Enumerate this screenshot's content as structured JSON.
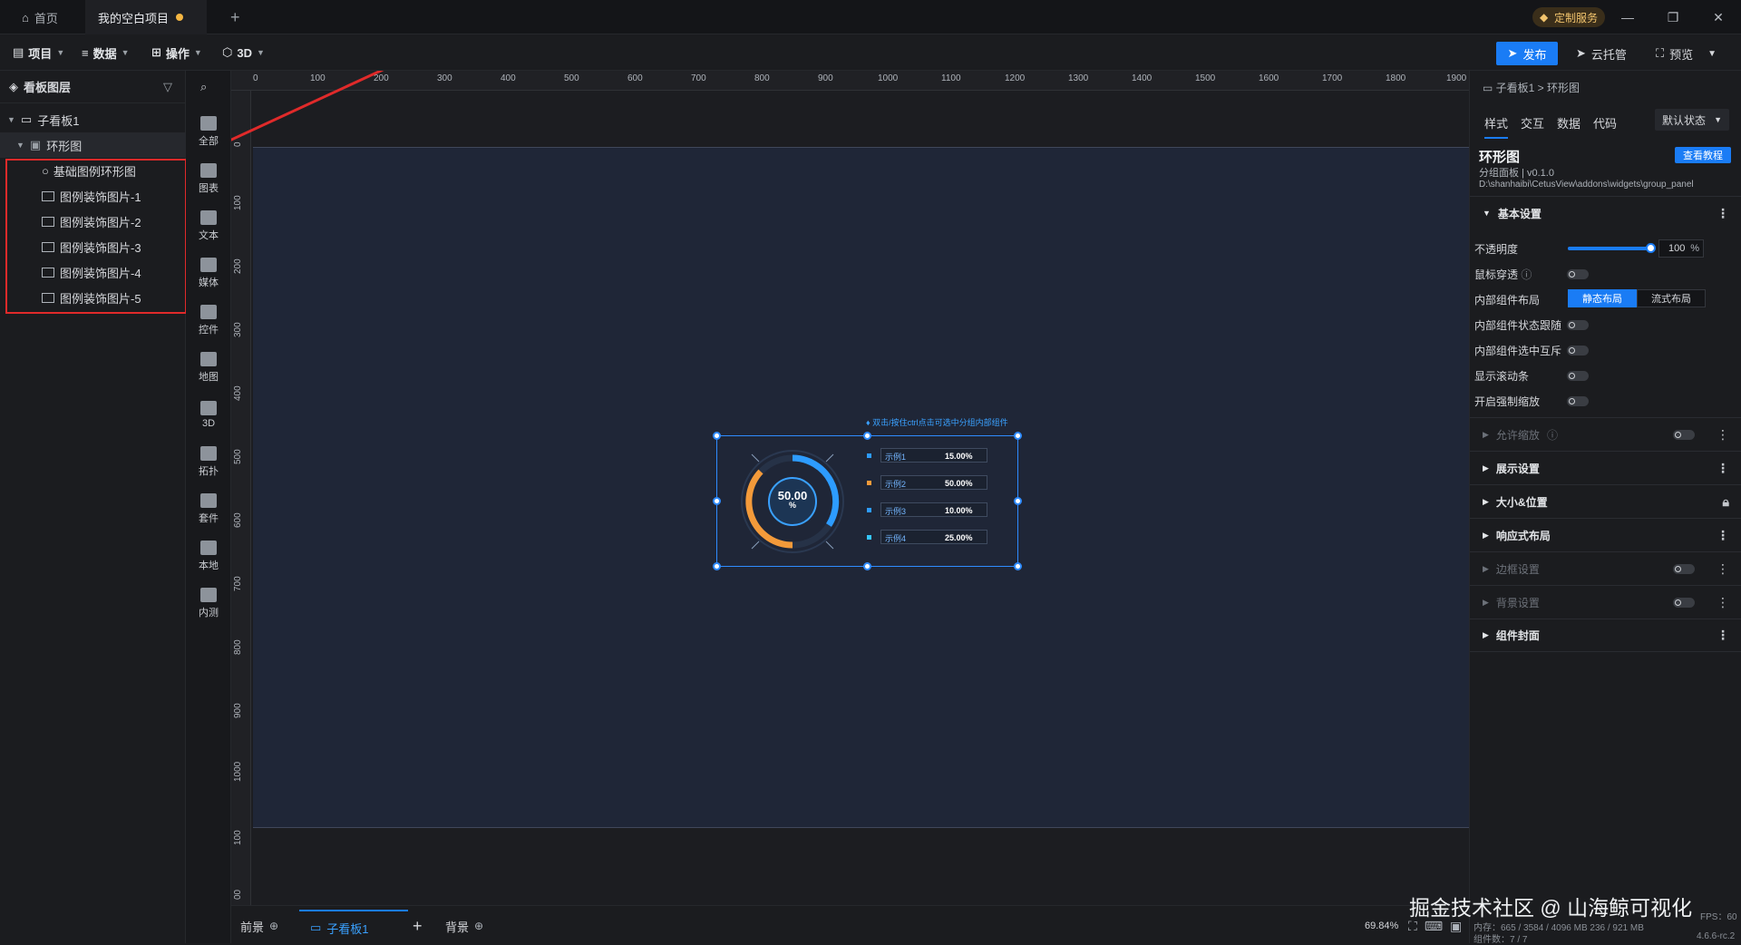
{
  "titlebar": {
    "home_tab": "首页",
    "project_tab": "我的空白项目",
    "new_tab": "+",
    "custom_service": "定制服务",
    "minimize": "—",
    "restore": "❐",
    "close": "✕"
  },
  "menubar": {
    "project": "项目",
    "data": "数据",
    "operate": "操作",
    "three_d": "3D",
    "publish": "发布",
    "cloud_host": "云托管",
    "preview": "预览"
  },
  "layers": {
    "title": "看板图层",
    "items": [
      {
        "label": "子看板1"
      },
      {
        "label": "环形图"
      },
      {
        "label": "基础图例环形图"
      },
      {
        "label": "图例装饰图片-1"
      },
      {
        "label": "图例装饰图片-2"
      },
      {
        "label": "图例装饰图片-3"
      },
      {
        "label": "图例装饰图片-4"
      },
      {
        "label": "图例装饰图片-5"
      }
    ]
  },
  "components": [
    "全部",
    "图表",
    "文本",
    "媒体",
    "控件",
    "地图",
    "3D",
    "拓扑",
    "套件",
    "本地",
    "内测"
  ],
  "ruler": {
    "top": [
      "0",
      "100",
      "200",
      "300",
      "400",
      "500",
      "600",
      "700",
      "800",
      "900",
      "1000",
      "1100",
      "1200",
      "1300",
      "1400",
      "1500",
      "1600",
      "1700",
      "1800",
      "1900"
    ],
    "left": [
      "0",
      "100",
      "200",
      "300",
      "400",
      "500",
      "600",
      "700",
      "800",
      "900",
      "1000",
      "100",
      "00"
    ]
  },
  "widget": {
    "hint": "双击/按住ctrl点击可选中分组内部组件",
    "center_value": "50.00",
    "center_unit": "%",
    "legend": [
      {
        "name": "示例1",
        "value": "15.00%",
        "color": "#2d9cff"
      },
      {
        "name": "示例2",
        "value": "50.00%",
        "color": "#f39a3a"
      },
      {
        "name": "示例3",
        "value": "10.00%",
        "color": "#2d9cff"
      },
      {
        "name": "示例4",
        "value": "25.00%",
        "color": "#35c6ff"
      }
    ]
  },
  "bottombar": {
    "foreground": "前景",
    "subboard": "子看板1",
    "add": "+",
    "background": "背景",
    "zoom": "69.84%",
    "memory": "内存：665 / 3584 / 4096 MB  236 / 921 MB",
    "fps": "FPS：60",
    "component_count": "组件数：7 / 7",
    "version": "4.6.6-rc.2"
  },
  "props": {
    "breadcrumb": "子看板1 > 环形图",
    "tabs": [
      "样式",
      "交互",
      "数据",
      "代码"
    ],
    "state_select": "默认状态",
    "widget_name": "环形图",
    "tutorial_button": "查看教程",
    "subtitle": "分组面板 | v0.1.0",
    "path": "D:\\shanhaibi\\CetusView\\addons\\widgets\\group_panel",
    "basic_section": "基本设置",
    "opacity_label": "不透明度",
    "opacity_value": "100",
    "opacity_unit": "%",
    "opacity_fraction": 1.0,
    "mouse_through": "鼠标穿透",
    "inner_layout": "内部组件布局",
    "layout_static": "静态布局",
    "layout_flow": "流式布局",
    "inner_state_follow": "内部组件状态跟随",
    "inner_select_exclusive": "内部组件选中互斥",
    "show_scrollbar": "显示滚动条",
    "force_scale": "开启强制缩放",
    "sections": [
      {
        "label": "允许缩放",
        "dim": true
      },
      {
        "label": "展示设置",
        "dim": false
      },
      {
        "label": "大小&位置",
        "dim": false
      },
      {
        "label": "响应式布局",
        "dim": false
      },
      {
        "label": "边框设置",
        "dim": true
      },
      {
        "label": "背景设置",
        "dim": true
      },
      {
        "label": "组件封面",
        "dim": false
      }
    ]
  },
  "watermark": "掘金技术社区 @ 山海鲸可视化",
  "colors": {
    "accent": "#1a7cf5",
    "highlight_box": "#e02a2a",
    "artboard": "#1f2637"
  }
}
